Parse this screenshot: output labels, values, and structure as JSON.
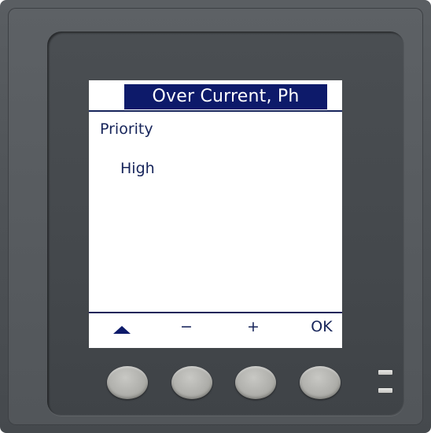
{
  "screen": {
    "title": "Over Current, Ph",
    "field_label": "Priority",
    "field_value": "High"
  },
  "softkeys": {
    "up_icon": "triangle-up-icon",
    "minus_label": "−",
    "plus_label": "+",
    "ok_label": "OK"
  },
  "colors": {
    "screen_text": "#16245a",
    "title_bg": "#0d1a6a",
    "bezel": "#4e5256",
    "button": "#b0b0ac"
  }
}
